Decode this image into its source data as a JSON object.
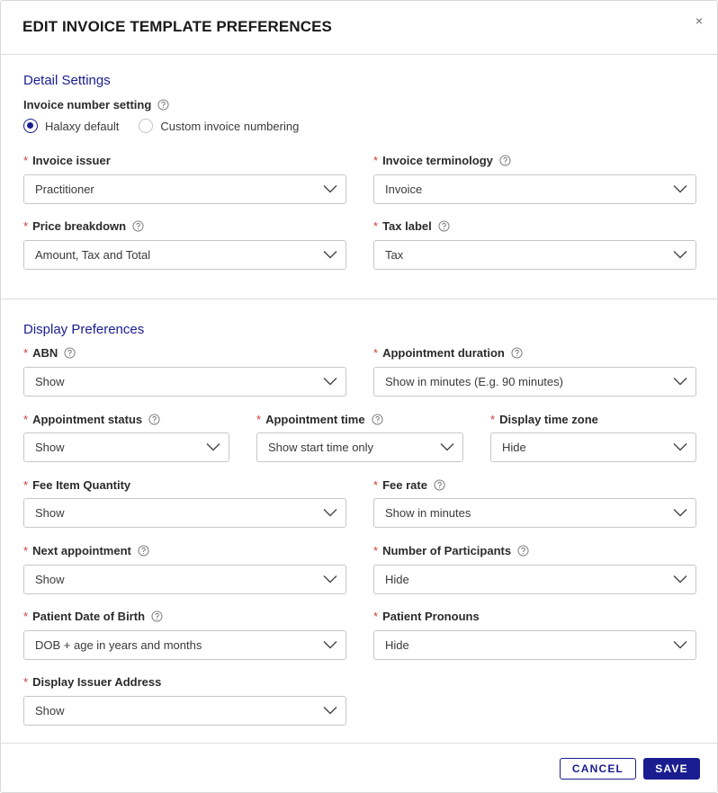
{
  "modal": {
    "title": "EDIT INVOICE TEMPLATE PREFERENCES",
    "close_label": "×"
  },
  "detail": {
    "section_title": "Detail Settings",
    "invoice_number_setting": {
      "label": "Invoice number setting",
      "options": [
        "Halaxy default",
        "Custom invoice numbering"
      ],
      "selected": "Halaxy default"
    },
    "invoice_issuer": {
      "label": "Invoice issuer",
      "value": "Practitioner"
    },
    "invoice_terminology": {
      "label": "Invoice terminology",
      "value": "Invoice"
    },
    "price_breakdown": {
      "label": "Price breakdown",
      "value": "Amount, Tax and Total"
    },
    "tax_label": {
      "label": "Tax label",
      "value": "Tax"
    }
  },
  "display": {
    "section_title": "Display Preferences",
    "abn": {
      "label": "ABN",
      "value": "Show"
    },
    "appointment_duration": {
      "label": "Appointment duration",
      "value": "Show in minutes (E.g. 90 minutes)"
    },
    "appointment_status": {
      "label": "Appointment status",
      "value": "Show"
    },
    "appointment_time": {
      "label": "Appointment time",
      "value": "Show start time only"
    },
    "display_time_zone": {
      "label": "Display time zone",
      "value": "Hide"
    },
    "fee_item_quantity": {
      "label": "Fee Item Quantity",
      "value": "Show"
    },
    "fee_rate": {
      "label": "Fee rate",
      "value": "Show in minutes"
    },
    "next_appointment": {
      "label": "Next appointment",
      "value": "Show"
    },
    "number_of_participants": {
      "label": "Number of Participants",
      "value": "Hide"
    },
    "patient_dob": {
      "label": "Patient Date of Birth",
      "value": "DOB + age in years and months"
    },
    "patient_pronouns": {
      "label": "Patient Pronouns",
      "value": "Hide"
    },
    "display_issuer_address": {
      "label": "Display Issuer Address",
      "value": "Show"
    }
  },
  "footer": {
    "cancel_label": "CANCEL",
    "save_label": "SAVE"
  },
  "required_marker": "*",
  "colors": {
    "accent": "#1a1d8f",
    "required": "#d23b3b",
    "border": "#c7c7c7"
  },
  "icons": {
    "help": "help-circle-icon",
    "chevron": "chevron-down-icon",
    "close": "close-icon"
  }
}
